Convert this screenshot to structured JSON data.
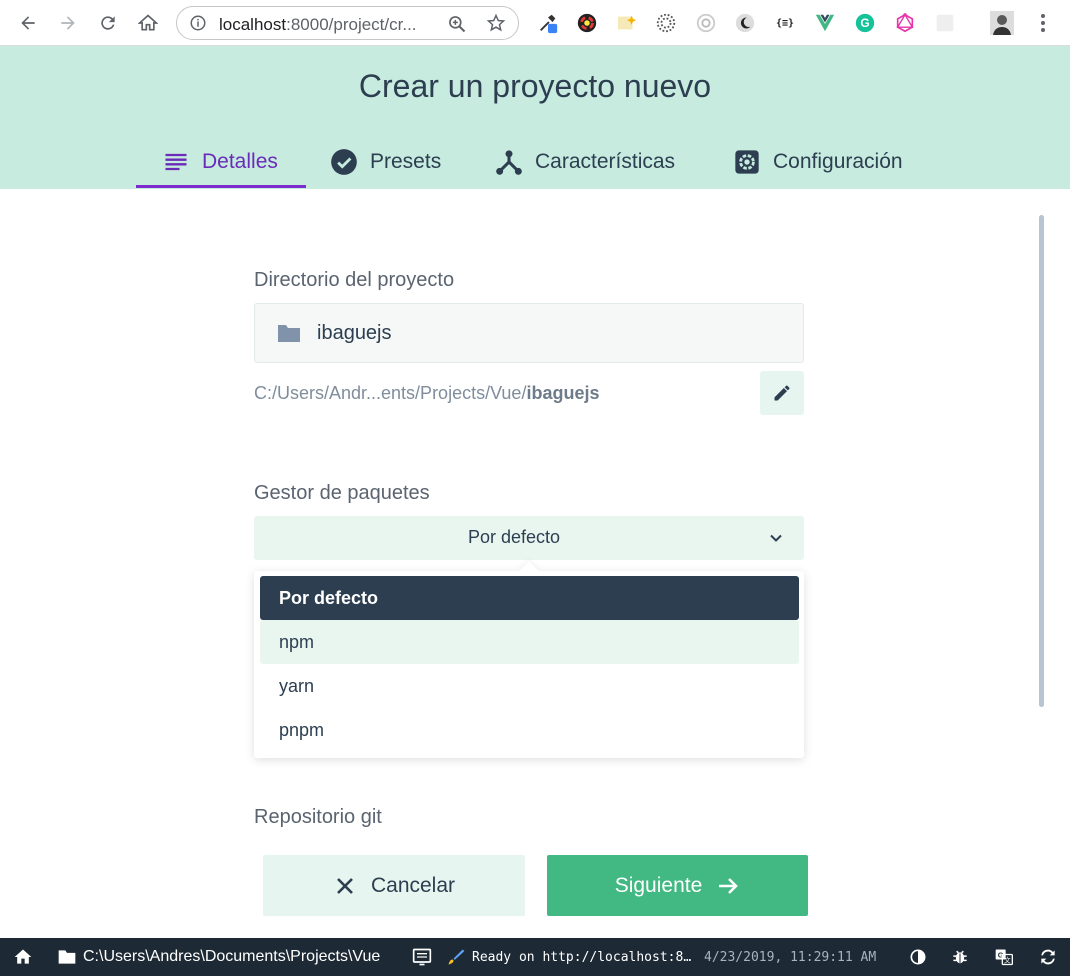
{
  "browser": {
    "url_host": "localhost",
    "url_rest": ":8000/project/cr..."
  },
  "header": {
    "title": "Crear un proyecto nuevo",
    "tabs": [
      {
        "label": "Detalles",
        "icon": "list-icon",
        "active": true
      },
      {
        "label": "Presets",
        "icon": "check-circle-icon",
        "active": false
      },
      {
        "label": "Características",
        "icon": "fork-icon",
        "active": false
      },
      {
        "label": "Configuración",
        "icon": "gear-icon",
        "active": false
      }
    ]
  },
  "project": {
    "label": "Directorio del proyecto",
    "folder_name": "ibaguejs",
    "path_prefix": "C:/Users/Andr...ents/Projects/Vue/",
    "path_bold": "ibaguejs"
  },
  "package_manager": {
    "label": "Gestor de paquetes",
    "selected": "Por defecto",
    "options": [
      "Por defecto",
      "npm",
      "yarn",
      "pnpm"
    ]
  },
  "git": {
    "label": "Repositorio git"
  },
  "actions": {
    "cancel": "Cancelar",
    "next": "Siguiente"
  },
  "status_bar": {
    "folder_path": "C:\\Users\\Andres\\Documents\\Projects\\Vue",
    "log": "Ready on http://localhost:8…",
    "timestamp": "4/23/2019, 11:29:11 AM"
  },
  "colors": {
    "header_bg": "#c7ebdf",
    "accent_purple": "#6a2bb8",
    "primary_green": "#42b983",
    "dark": "#2c3e50",
    "status_bar_bg": "#1d2935"
  }
}
